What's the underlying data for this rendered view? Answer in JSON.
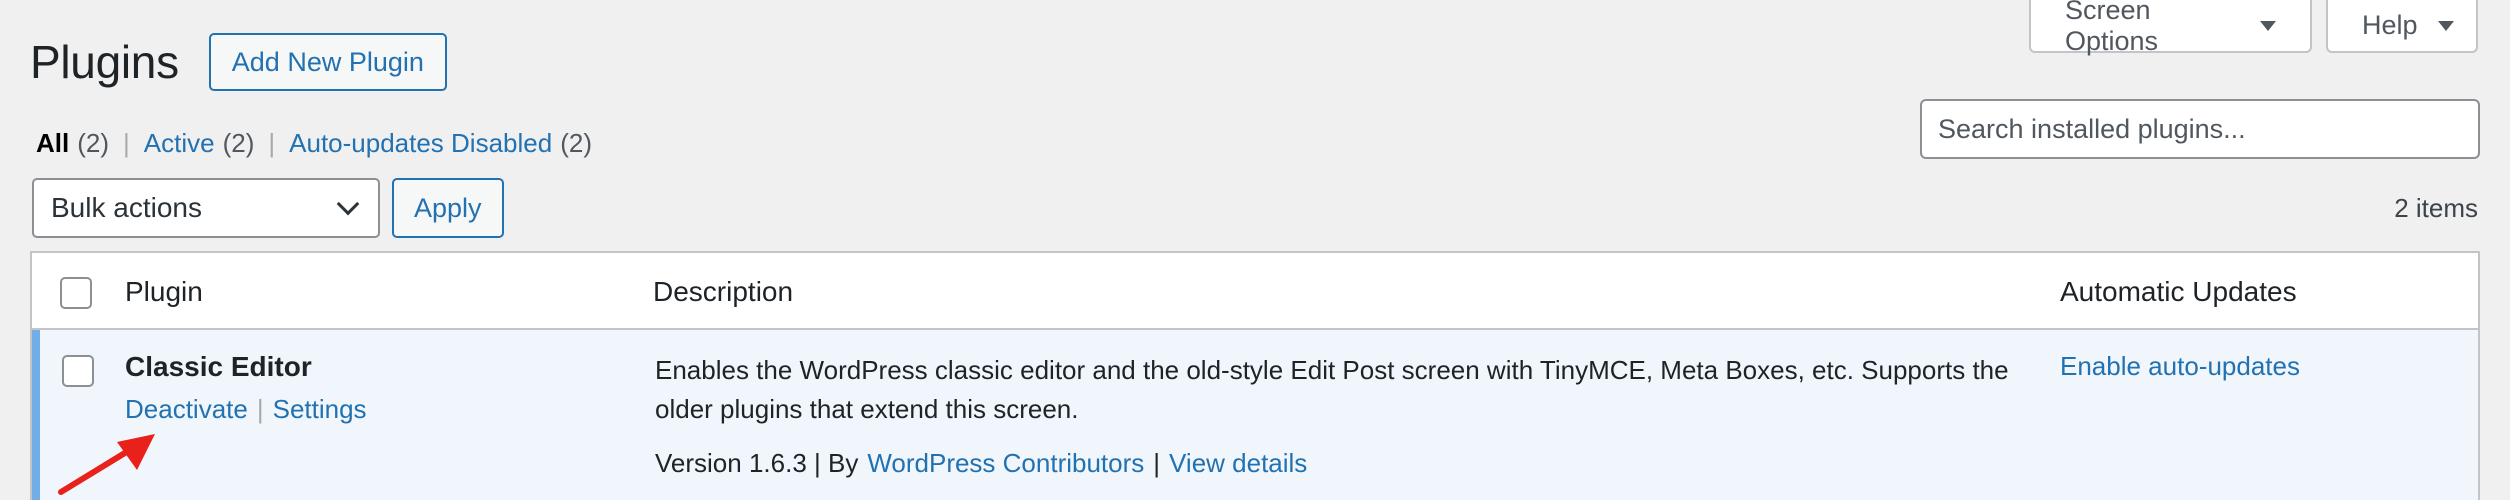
{
  "header": {
    "title": "Plugins",
    "add_new_label": "Add New Plugin",
    "screen_options_label": "Screen Options",
    "help_label": "Help"
  },
  "filters": {
    "all": {
      "label": "All",
      "count": "(2)"
    },
    "active": {
      "label": "Active",
      "count": "(2)"
    },
    "auto_disabled": {
      "label": "Auto-updates Disabled",
      "count": "(2)"
    },
    "separator": "|"
  },
  "search": {
    "placeholder": "Search installed plugins..."
  },
  "bulk": {
    "selected": "Bulk actions",
    "apply_label": "Apply"
  },
  "items_count": "2 items",
  "table": {
    "columns": {
      "plugin": "Plugin",
      "description": "Description",
      "auto_updates": "Automatic Updates"
    },
    "rows": [
      {
        "name": "Classic Editor",
        "actions": [
          "Deactivate",
          "Settings"
        ],
        "description": "Enables the WordPress classic editor and the old-style Edit Post screen with TinyMCE, Meta Boxes, etc. Supports the older plugins that extend this screen.",
        "version_text": "Version 1.6.3 | By",
        "author_link": "WordPress Contributors",
        "view_details": "View details",
        "auto_update_link": "Enable auto-updates"
      }
    ]
  },
  "annotation": {
    "color": "#e8221b",
    "icon": "red-arrow-icon"
  },
  "colors": {
    "link": "#2271b1",
    "active_row_bg": "#f0f6fc",
    "active_row_border": "#72aee6",
    "page_bg": "#f0f0f1"
  }
}
